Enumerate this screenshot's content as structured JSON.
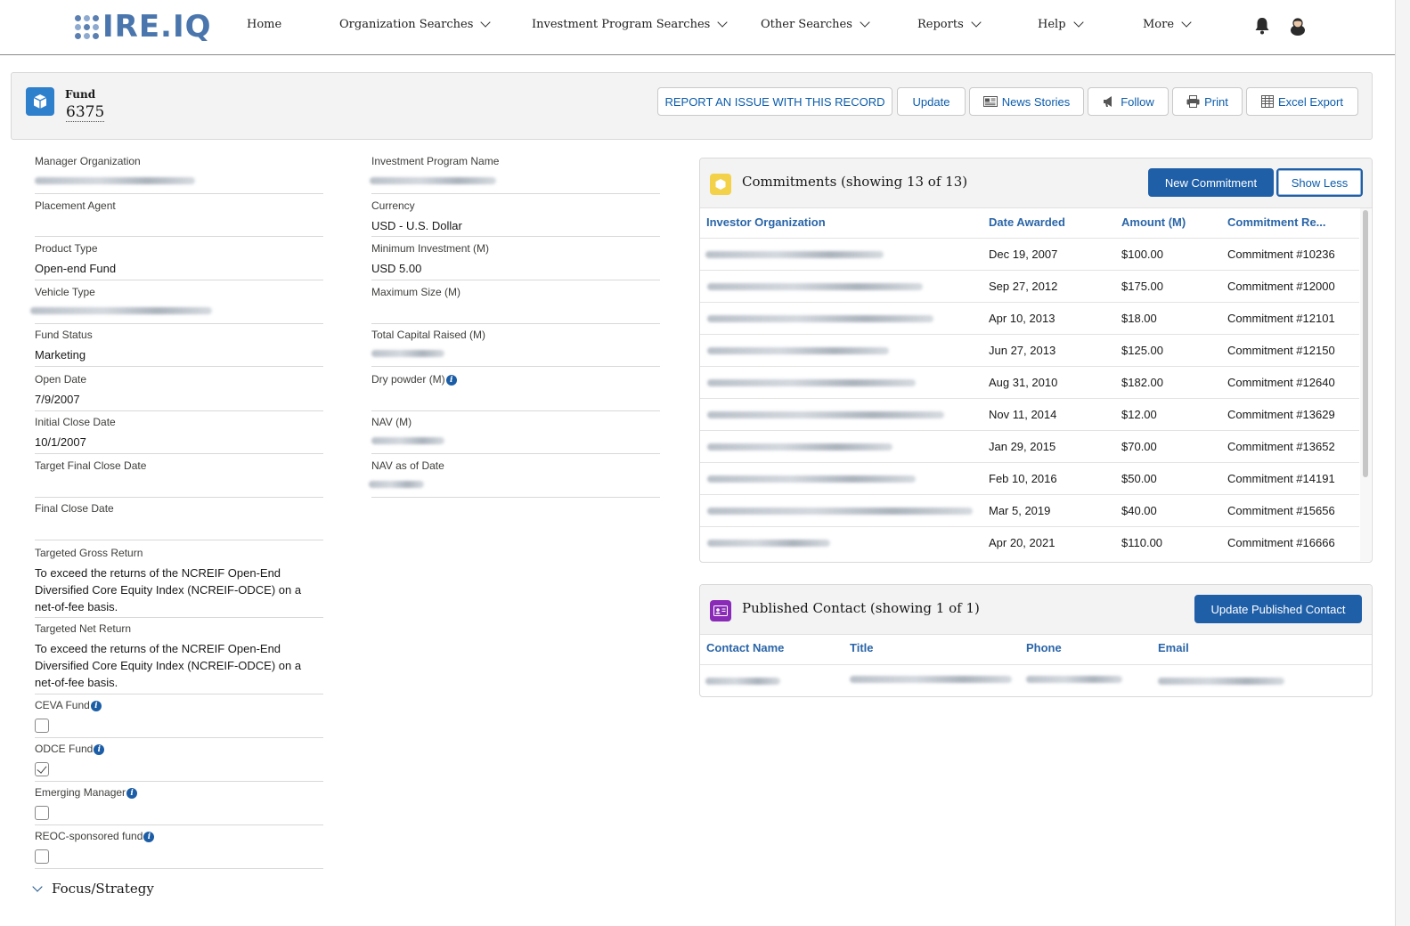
{
  "nav": {
    "logo": "IRE.IQ",
    "items": [
      "Home",
      "Organization Searches",
      "Investment Program Searches",
      "Other Searches",
      "Reports",
      "Help",
      "More"
    ]
  },
  "header": {
    "record_type": "Fund",
    "record_name": "6375",
    "buttons": {
      "report": "REPORT AN ISSUE WITH THIS RECORD",
      "update": "Update",
      "news": "News Stories",
      "follow": "Follow",
      "print": "Print",
      "excel": "Excel Export"
    }
  },
  "left": {
    "manager_organization": {
      "label": "Manager Organization"
    },
    "placement_agent": {
      "label": "Placement Agent",
      "value": ""
    },
    "product_type": {
      "label": "Product Type",
      "value": "Open-end Fund"
    },
    "vehicle_type": {
      "label": "Vehicle Type"
    },
    "fund_status": {
      "label": "Fund Status",
      "value": "Marketing"
    },
    "open_date": {
      "label": "Open Date",
      "value": "7/9/2007"
    },
    "initial_close_date": {
      "label": "Initial Close Date",
      "value": "10/1/2007"
    },
    "target_final_close_date": {
      "label": "Target Final Close Date",
      "value": ""
    },
    "final_close_date": {
      "label": "Final Close Date",
      "value": ""
    },
    "targeted_gross_return": {
      "label": "Targeted Gross Return",
      "value": "To exceed the returns of the NCREIF Open-End Diversified Core Equity Index (NCREIF-ODCE) on a net-of-fee basis."
    },
    "targeted_net_return": {
      "label": "Targeted Net Return",
      "value": "To exceed the returns of the NCREIF Open-End Diversified Core Equity Index (NCREIF-ODCE) on a net-of-fee basis."
    },
    "ceva_fund": {
      "label": "CEVA Fund",
      "checked": false
    },
    "odce_fund": {
      "label": "ODCE Fund",
      "checked": true
    },
    "emerging_manager": {
      "label": "Emerging Manager",
      "checked": false
    },
    "reoc_sponsored_fund": {
      "label": "REOC-sponsored fund",
      "checked": false
    },
    "focus_strategy": "Focus/Strategy"
  },
  "middle": {
    "investment_program_name": {
      "label": "Investment Program Name"
    },
    "currency": {
      "label": "Currency",
      "value": "USD - U.S. Dollar"
    },
    "minimum_investment": {
      "label": "Minimum Investment (M)",
      "value": "USD 5.00"
    },
    "maximum_size": {
      "label": "Maximum Size (M)",
      "value": ""
    },
    "total_capital_raised": {
      "label": "Total Capital Raised (M)"
    },
    "dry_powder": {
      "label": "Dry powder (M)",
      "value": ""
    },
    "nav": {
      "label": "NAV (M)"
    },
    "nav_as_of_date": {
      "label": "NAV as of Date"
    }
  },
  "commitments": {
    "title": "Commitments (showing 13 of 13)",
    "new_button": "New Commitment",
    "toggle_button": "Show Less",
    "columns": [
      "Investor Organization",
      "Date Awarded",
      "Amount (M)",
      "Commitment Re..."
    ],
    "rows": [
      {
        "date": "Dec 19, 2007",
        "amount": "$100.00",
        "ref": "Commitment #10236"
      },
      {
        "date": "Sep 27, 2012",
        "amount": "$175.00",
        "ref": "Commitment #12000"
      },
      {
        "date": "Apr 10, 2013",
        "amount": "$18.00",
        "ref": "Commitment #12101"
      },
      {
        "date": "Jun 27, 2013",
        "amount": "$125.00",
        "ref": "Commitment #12150"
      },
      {
        "date": "Aug 31, 2010",
        "amount": "$182.00",
        "ref": "Commitment #12640"
      },
      {
        "date": "Nov 11, 2014",
        "amount": "$12.00",
        "ref": "Commitment #13629"
      },
      {
        "date": "Jan 29, 2015",
        "amount": "$70.00",
        "ref": "Commitment #13652"
      },
      {
        "date": "Feb 10, 2016",
        "amount": "$50.00",
        "ref": "Commitment #14191"
      },
      {
        "date": "Mar 5, 2019",
        "amount": "$40.00",
        "ref": "Commitment #15656"
      },
      {
        "date": "Apr 20, 2021",
        "amount": "$110.00",
        "ref": "Commitment #16666"
      }
    ]
  },
  "contacts": {
    "title": "Published Contact (showing 1 of 1)",
    "update_button": "Update Published Contact",
    "columns": [
      "Contact Name",
      "Title",
      "Phone",
      "Email"
    ]
  },
  "colors": {
    "brand": "#4a76ad",
    "link": "#0b5cab",
    "primary_button": "#1f5fa8",
    "commitments_icon": "#f3d24a",
    "contact_icon": "#8a2bb8"
  }
}
